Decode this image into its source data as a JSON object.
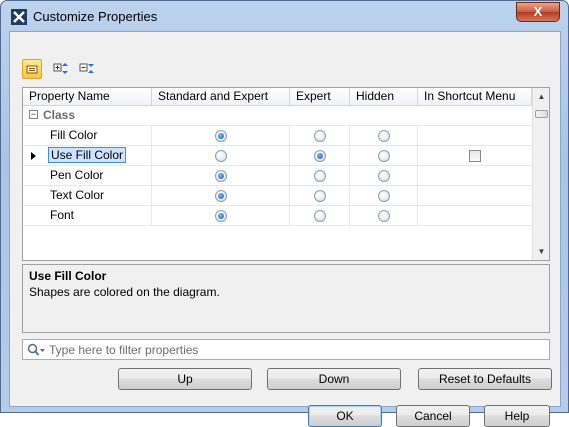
{
  "window": {
    "title": "Customize Properties",
    "close_label": "X"
  },
  "toolbar": {
    "icons": [
      "list-view-icon",
      "expand-all-icon",
      "collapse-all-icon"
    ]
  },
  "grid": {
    "columns": [
      "Property Name",
      "Standard and Expert",
      "Expert",
      "Hidden",
      "In Shortcut Menu"
    ],
    "group": {
      "label": "Class",
      "expander": "−"
    },
    "rows": [
      {
        "name": "Fill Color",
        "mode": "Standard and Expert",
        "shortcut": null,
        "selected": false
      },
      {
        "name": "Use Fill Color",
        "mode": "Expert",
        "shortcut": false,
        "selected": true
      },
      {
        "name": "Pen Color",
        "mode": "Standard and Expert",
        "shortcut": null,
        "selected": false
      },
      {
        "name": "Text Color",
        "mode": "Standard and Expert",
        "shortcut": null,
        "selected": false
      },
      {
        "name": "Font",
        "mode": "Standard and Expert",
        "shortcut": null,
        "selected": false
      }
    ]
  },
  "description": {
    "title": "Use Fill Color",
    "text": "Shapes are colored on the diagram."
  },
  "filter": {
    "placeholder": "Type here to filter properties",
    "value": ""
  },
  "buttons": {
    "up": "Up",
    "down": "Down",
    "reset": "Reset to Defaults",
    "ok": "OK",
    "cancel": "Cancel",
    "help": "Help"
  },
  "colors": {
    "selection": "#cce4ff",
    "selection_border": "#3d8be3",
    "close": "#c75a3f",
    "active_toolbar": "#f7c54a"
  }
}
